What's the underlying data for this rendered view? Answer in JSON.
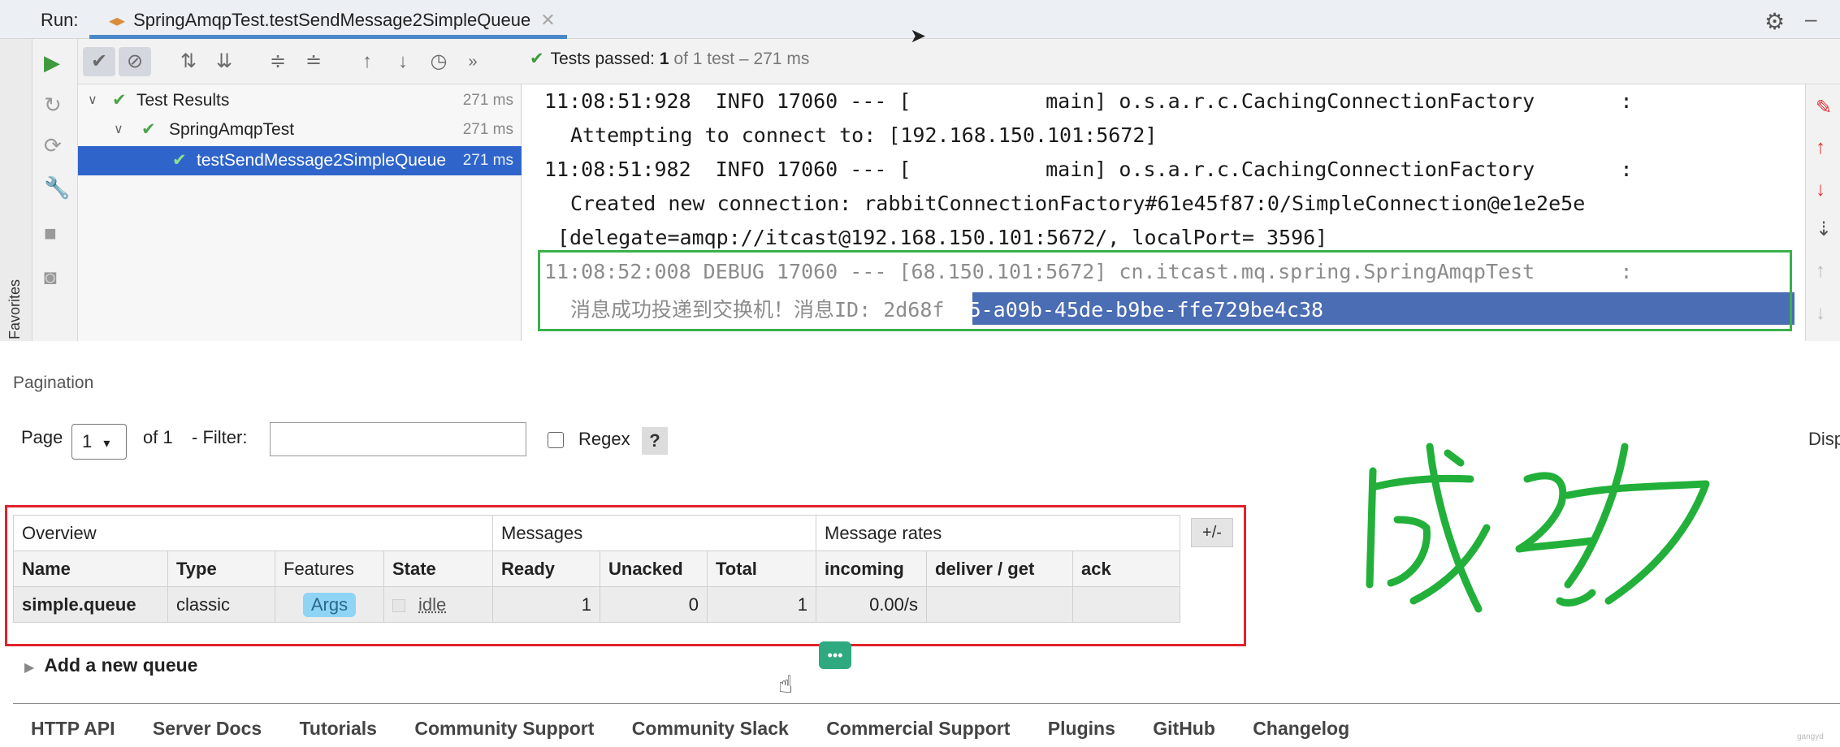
{
  "ide": {
    "run_label": "Run:",
    "run_tab": "SpringAmqpTest.testSendMessage2SimpleQueue",
    "favorites_label": "Favorites",
    "toolbar_icons": [
      "run-icon",
      "checkmark-filter-icon",
      "stop-filter-icon",
      "sort-alpha-icon",
      "sort-duration-icon",
      "expand-all-icon",
      "collapse-all-icon",
      "prev-icon",
      "next-icon",
      "history-icon",
      "more-icon"
    ],
    "tests_passed": {
      "label": "Tests passed:",
      "count": "1",
      "detail": "of 1 test – 271 ms"
    },
    "tree": [
      {
        "label": "Test Results",
        "time": "271 ms"
      },
      {
        "label": "SpringAmqpTest",
        "time": "271 ms"
      },
      {
        "label": "testSendMessage2SimpleQueue",
        "time": "271 ms"
      }
    ],
    "console": {
      "line1": "11:08:51:928  INFO 17060 --- [           main] o.s.a.r.c.CachingConnectionFactory       :",
      "line2": "Attempting to connect to: [192.168.150.101:5672]",
      "line3": "11:08:51:982  INFO 17060 --- [           main] o.s.a.r.c.CachingConnectionFactory       :",
      "line4": "Created new connection: rabbitConnectionFactory#61e45f87:0/SimpleConnection@e1e2e5e",
      "line5": "[delegate=amqp://itcast@192.168.150.101:5672/, localPort= 3596]",
      "line6": "11:08:52:008 DEBUG 17060 --- [68.150.101:5672] cn.itcast.mq.spring.SpringAmqpTest       :",
      "line7_prefix": "消息成功投递到交换机！消息ID: 2d68f",
      "line7_selected": "d25-a09b-45de-b9be-ffe729be4c38"
    }
  },
  "rabbit": {
    "pagination_title": "Pagination",
    "page_label": "Page",
    "page_value": "1",
    "of_label": "of 1",
    "filter_label": "- Filter:",
    "regex_label": "Regex",
    "help_label": "?",
    "disp_text": "Disp",
    "table": {
      "groups": {
        "overview": "Overview",
        "messages": "Messages",
        "rates": "Message rates"
      },
      "headers": [
        "Name",
        "Type",
        "Features",
        "State",
        "Ready",
        "Unacked",
        "Total",
        "incoming",
        "deliver / get",
        "ack"
      ],
      "row": {
        "name": "simple.queue",
        "type": "classic",
        "features": "Args",
        "state": "idle",
        "ready": "1",
        "unacked": "0",
        "total": "1",
        "incoming": "0.00/s",
        "deliver": "",
        "ack": ""
      }
    },
    "plus_minus": "+/-",
    "add_queue": "Add a new queue",
    "footer": [
      "HTTP API",
      "Server Docs",
      "Tutorials",
      "Community Support",
      "Community Slack",
      "Commercial Support",
      "Plugins",
      "GitHub",
      "Changelog"
    ]
  },
  "annotation": {
    "handwriting_text": "成功",
    "color": "#22b03a"
  },
  "watermark": "gangyd"
}
